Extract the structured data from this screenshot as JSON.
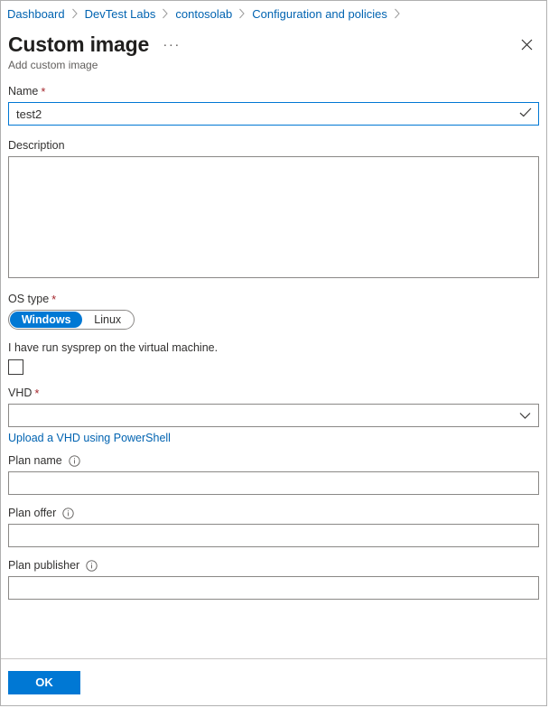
{
  "breadcrumb": {
    "items": [
      {
        "label": "Dashboard"
      },
      {
        "label": "DevTest Labs"
      },
      {
        "label": "contosolab"
      },
      {
        "label": "Configuration and policies"
      }
    ]
  },
  "header": {
    "title": "Custom image",
    "subtitle": "Add custom image",
    "more_menu_label": "···",
    "more_menu_icon": "ellipsis-icon",
    "close_icon": "close-icon"
  },
  "form": {
    "name": {
      "label": "Name",
      "required": true,
      "value": "test2",
      "placeholder": "",
      "valid_icon": "checkmark-icon"
    },
    "description": {
      "label": "Description",
      "required": false,
      "value": "",
      "placeholder": ""
    },
    "os_type": {
      "label": "OS type",
      "required": true,
      "options": [
        {
          "label": "Windows",
          "selected": true
        },
        {
          "label": "Linux",
          "selected": false
        }
      ]
    },
    "sysprep": {
      "label": "I have run sysprep on the virtual machine.",
      "checked": false
    },
    "vhd": {
      "label": "VHD",
      "required": true,
      "value": "",
      "selected_option": "",
      "options": [
        ""
      ],
      "chevron_icon": "chevron-down-icon"
    },
    "upload_link": {
      "label": "Upload a VHD using PowerShell"
    },
    "plan_name": {
      "label": "Plan name",
      "required": false,
      "value": "",
      "placeholder": "",
      "info_icon": "info-icon"
    },
    "plan_offer": {
      "label": "Plan offer",
      "required": false,
      "value": "",
      "placeholder": "",
      "info_icon": "info-icon"
    },
    "plan_publisher": {
      "label": "Plan publisher",
      "required": false,
      "value": "",
      "placeholder": "",
      "info_icon": "info-icon"
    }
  },
  "footer": {
    "ok_label": "OK"
  },
  "colors": {
    "accent": "#0078d4",
    "link": "#0063b1",
    "required_asterisk": "#a4262c",
    "border": "#8a8886",
    "text": "#323130",
    "subtle_text": "#605e5c"
  }
}
